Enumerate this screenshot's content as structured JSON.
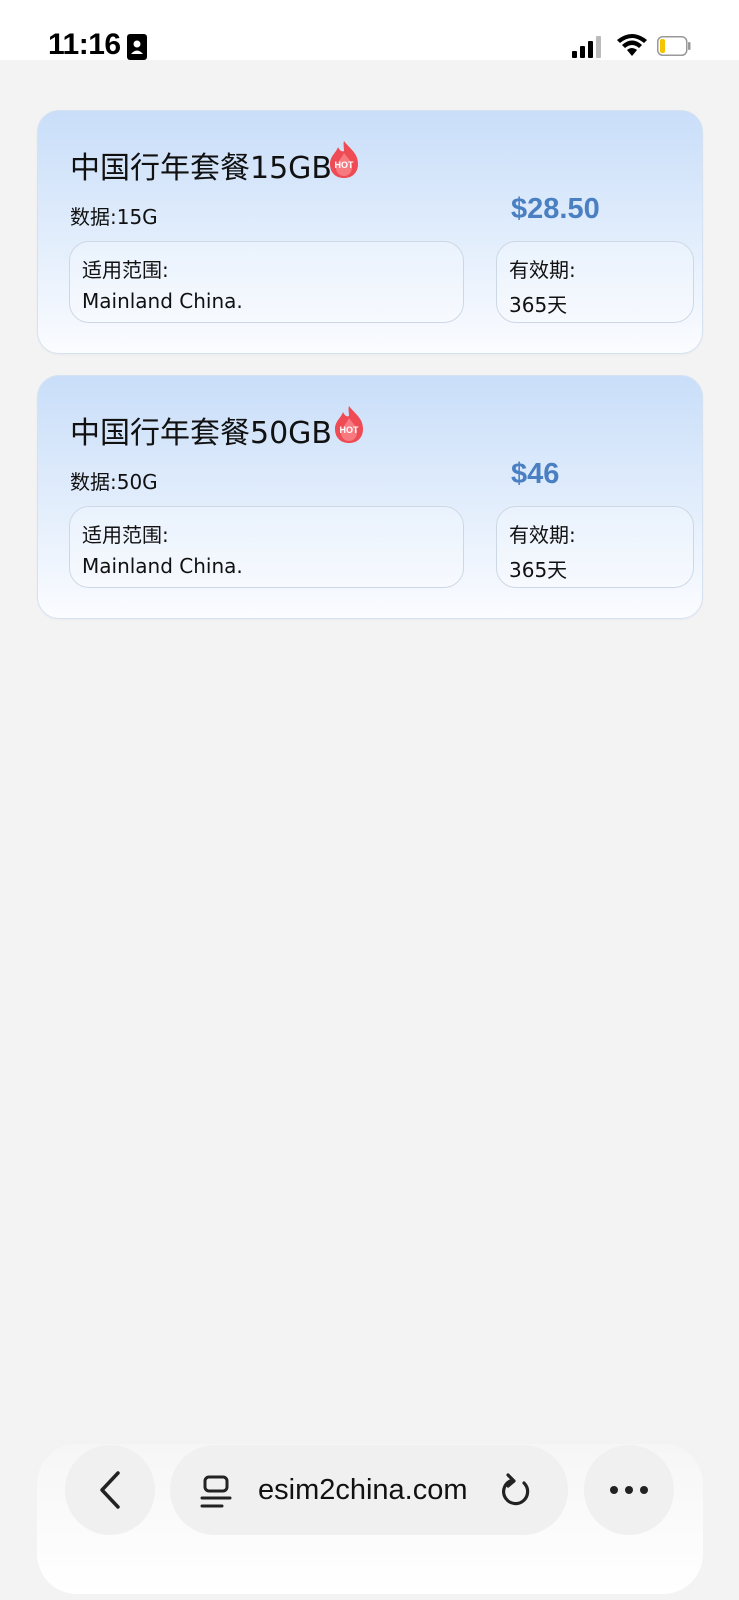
{
  "status_bar": {
    "time": "11:16",
    "icons": [
      "contact-card-icon",
      "signal-icon",
      "wifi-icon",
      "battery-icon"
    ],
    "battery_color": "#f5c400"
  },
  "plans": [
    {
      "title": "中国行年套餐15GB",
      "badge": "HOT",
      "data": "数据:15G",
      "price": "$28.50",
      "scope_label": "适用范围:",
      "scope_value": "Mainland China.",
      "validity_label": "有效期:",
      "validity_value": "365天"
    },
    {
      "title": "中国行年套餐50GB",
      "badge": "HOT",
      "data": "数据:50G",
      "price": "$46",
      "scope_label": "适用范围:",
      "scope_value": "Mainland China.",
      "validity_label": "有效期:",
      "validity_value": "365天"
    }
  ],
  "colors": {
    "price": "#4a7fc2",
    "card_gradient_top": "#c9def9",
    "hot_badge": "#e8434b"
  },
  "toolbar": {
    "url": "esim2china.com",
    "icons": [
      "chevron-left-icon",
      "tabs-icon",
      "reload-icon",
      "more-icon"
    ]
  }
}
